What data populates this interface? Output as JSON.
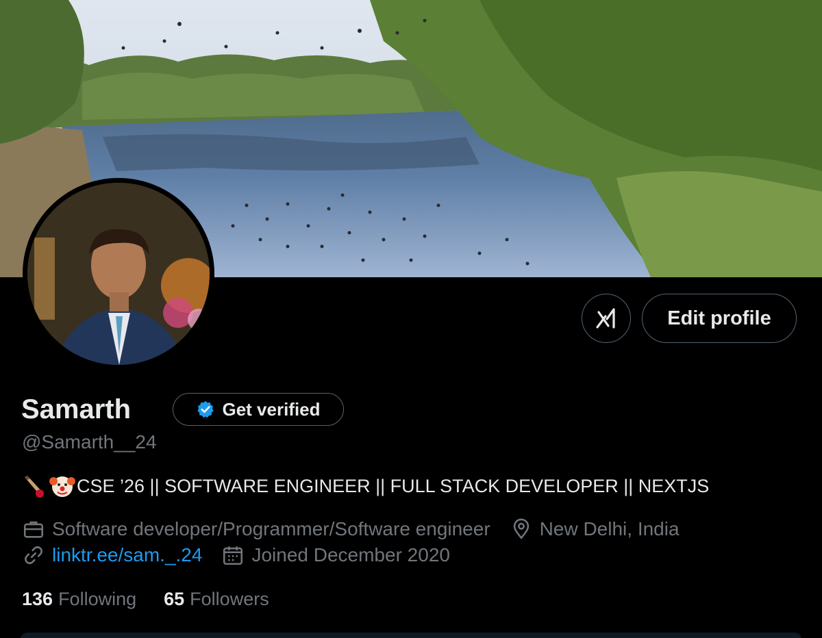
{
  "profile": {
    "display_name": "Samarth",
    "handle": "@Samarth__24",
    "verify_button_label": "Get verified",
    "bio_text": "CSE ’26 || SOFTWARE ENGINEER || FULL STACK DEVELOPER || NEXTJS",
    "bio_emojis": [
      "cricket-bat-emoji",
      "clown-face-emoji"
    ],
    "profession": "Software developer/Programmer/Software engineer",
    "location": "New Delhi, India",
    "website": "linktr.ee/sam._.24",
    "joined": "Joined December 2020"
  },
  "actions": {
    "grok_icon": "grok-icon",
    "edit_profile_label": "Edit profile"
  },
  "stats": {
    "following_count": "136",
    "following_label": "Following",
    "followers_count": "65",
    "followers_label": "Followers"
  },
  "icons": {
    "profession": "briefcase-icon",
    "location": "location-pin-icon",
    "website": "link-icon",
    "joined": "calendar-icon",
    "verified": "verified-badge-icon"
  },
  "colors": {
    "background": "#000000",
    "primary_text": "#e7e9ea",
    "secondary_text": "#71767b",
    "link": "#1d9bf0",
    "verified_badge": "#1d9bf0",
    "button_border": "#536471"
  }
}
